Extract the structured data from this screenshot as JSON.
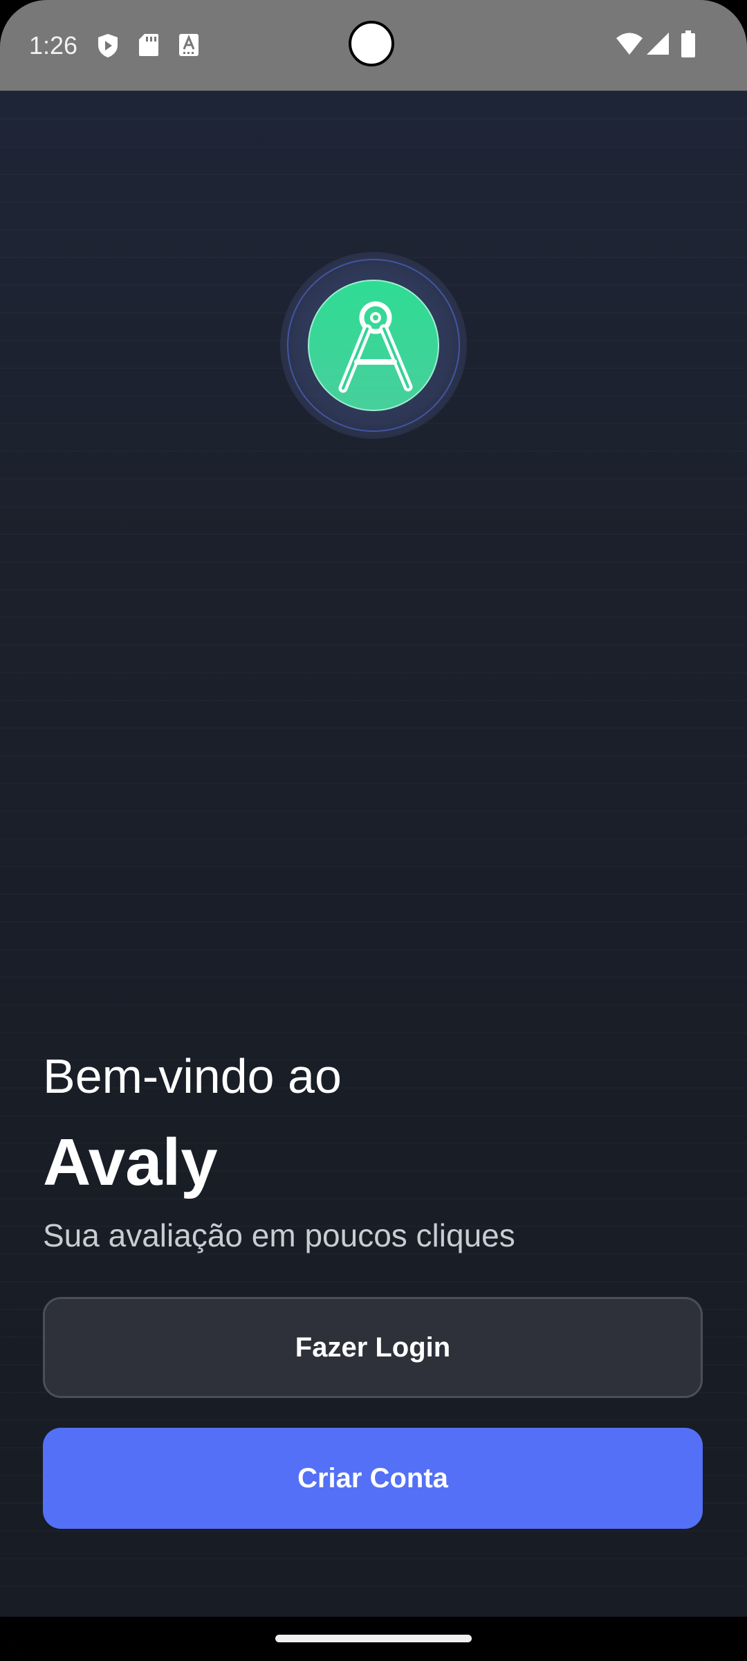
{
  "status_bar": {
    "time": "1:26",
    "left_icons": [
      "shield-play-icon",
      "sd-card-icon",
      "font-a-icon"
    ],
    "right_icons": [
      "wifi-icon",
      "signal-icon",
      "battery-icon"
    ]
  },
  "logo": {
    "icon": "compass-a-logo-icon",
    "circle_color": "#34d399",
    "ring_color": "#3b4a8a"
  },
  "welcome": {
    "line1": "Bem-vindo ao",
    "app_name": "Avaly",
    "tagline": "Sua avaliação em poucos cliques"
  },
  "actions": {
    "login_label": "Fazer Login",
    "signup_label": "Criar Conta",
    "signup_color": "#5470f7"
  }
}
